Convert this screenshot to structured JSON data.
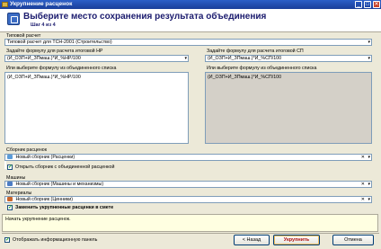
{
  "window": {
    "title": "Укрупнение расценок",
    "minimize_glyph": "_",
    "maximize_glyph": "□",
    "close_glyph": "✕"
  },
  "header": {
    "title": "Выберите место сохранения результата объединения",
    "step": "Шаг 4 из 4"
  },
  "form": {
    "type_label": "Типовой расчет",
    "type_value": "Типовой расчет для ТСН-2001 (Строительство)",
    "hr_label": "Задайте формулу для расчета итоговой НР",
    "hr_value": "(И_ОЗП+И_ЗПмаш.)*И_%НР/100",
    "sp_label": "Задайте формулу для расчета итоговой СП",
    "sp_value": "(И_ОЗП+И_ЗПмаш.)*И_%СП/100",
    "hr_list_label": "Или выберите формулу из объединенного списка",
    "hr_list_item": "(И_ОЗП+И_ЗПмаш.)*И_%НР/100",
    "sp_list_label": "Или выберите формулу из объединенного списка",
    "sp_list_item": "(И_ОЗП+И_ЗПмаш.)*И_%СП/100",
    "collection_label": "Сборник расценок",
    "collection_value": "Новый сборник (Расценки)",
    "open_checkbox_label": "Открыть сборник с объединенной расценкой",
    "open_checkbox_checked": true,
    "machines_label": "Машины",
    "machines_value": "Новый сборник (Машины и механизмы)",
    "materials_label": "Материалы",
    "materials_value": "Новый сборник (Ценники)",
    "replace_checkbox_label": "Заменить укрупненные расценки в смете",
    "replace_checkbox_checked": true,
    "clear_glyph": "✕",
    "dropdown_glyph": "▾"
  },
  "status": {
    "text": "Начать укрупнение расценок."
  },
  "footer": {
    "info_panel_label": "Отображать информационную панель",
    "info_panel_checked": true,
    "back_label": "< Назад",
    "primary_label": "Укрупнить",
    "cancel_label": "Отмена"
  },
  "colors": {
    "titlebar": "#2c5fc8",
    "dialog_bg": "#ece9d8",
    "header_text": "#1b1b6e",
    "status_bg": "#ffffe1",
    "primary_text": "#b01010"
  }
}
